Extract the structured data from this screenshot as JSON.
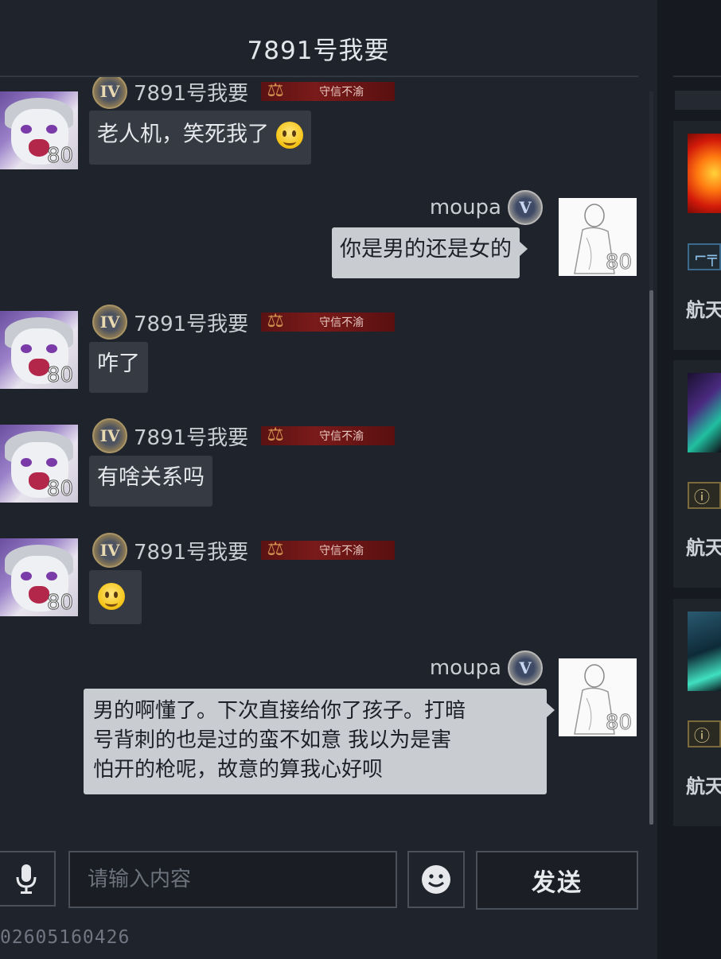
{
  "window": {
    "title": "7891号我要"
  },
  "messages": [
    {
      "sender": "7891号我要",
      "rank": "IV",
      "honor": "守信不渝",
      "level": "80",
      "text": "老人机，笑死我了",
      "emoji": "laughing-tears-emoji"
    },
    {
      "sender": "moupa",
      "rank": "V",
      "level": "80",
      "text": "你是男的还是女的",
      "mine": true
    },
    {
      "sender": "7891号我要",
      "rank": "IV",
      "honor": "守信不渝",
      "level": "80",
      "text": "咋了"
    },
    {
      "sender": "7891号我要",
      "rank": "IV",
      "honor": "守信不渝",
      "level": "80",
      "text": "有啥关系吗"
    },
    {
      "sender": "7891号我要",
      "rank": "IV",
      "honor": "守信不渝",
      "level": "80",
      "text": "",
      "emoji": "smile-emoji"
    },
    {
      "sender": "moupa",
      "rank": "V",
      "level": "80",
      "mine": true,
      "lines": [
        "男的啊懂了。下次直接给你了孩子。打暗",
        "号背刺的也是过的蛮不如意 我以为是害",
        "怕开的枪呢，故意的算我心好呗"
      ]
    }
  ],
  "input": {
    "placeholder": "请输入内容",
    "value": ""
  },
  "send_label": "发送",
  "footer_id": "02605160426",
  "right_panel": {
    "labels": [
      "航天",
      "航天",
      "航天"
    ]
  },
  "colors": {
    "background": "#1f232b",
    "bubble_other": "#353a43",
    "bubble_mine": "#c9ccd1",
    "honor_tag": "#7a1a1a"
  }
}
